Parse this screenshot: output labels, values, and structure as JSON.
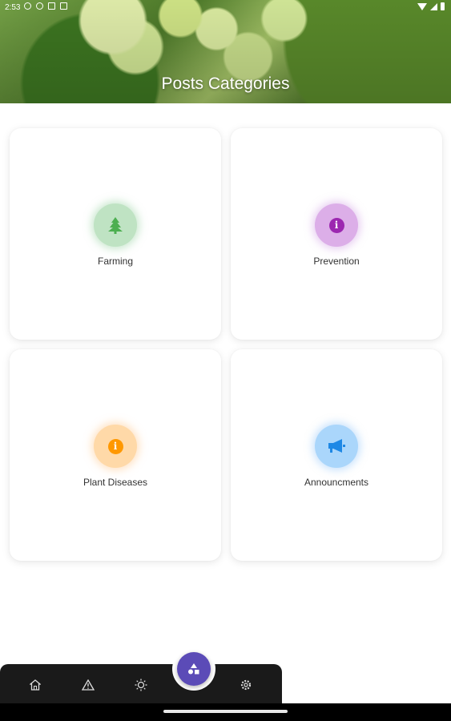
{
  "status_bar": {
    "time": "2:53"
  },
  "header": {
    "title": "Posts Categories"
  },
  "categories": [
    {
      "label": "Farming",
      "icon": "tree-icon",
      "color": "#4caf50"
    },
    {
      "label": "Prevention",
      "icon": "info-icon",
      "color": "#9c27b0",
      "glyph": "i"
    },
    {
      "label": "Plant Diseases",
      "icon": "info-icon",
      "color": "#ff9800",
      "glyph": "i"
    },
    {
      "label": "Announcments",
      "icon": "megaphone-icon",
      "color": "#1e88e5"
    }
  ],
  "bottom_nav": {
    "items": [
      "home-icon",
      "warning-icon",
      "sun-icon",
      "categories-icon",
      "settings-icon"
    ],
    "active": "categories-icon",
    "accent": "#5b4bb7"
  }
}
